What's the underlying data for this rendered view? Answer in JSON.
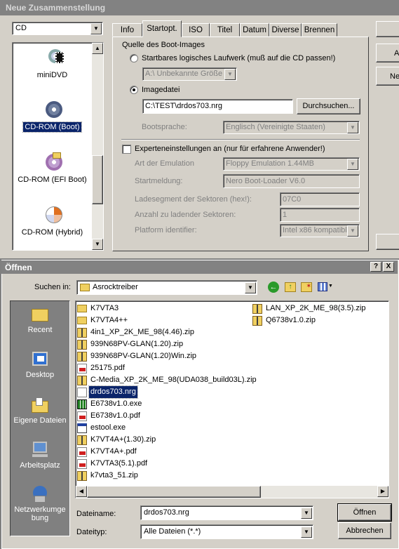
{
  "window": {
    "title": "Neue Zusammenstellung"
  },
  "disc_type": {
    "value": "CD"
  },
  "sidebar_items": [
    {
      "label": "miniDVD",
      "icon": "minidvd-icon"
    },
    {
      "label": "CD-ROM (Boot)",
      "icon": "cd-boot-icon",
      "selected": true
    },
    {
      "label": "CD-ROM (EFI Boot)",
      "icon": "cd-efi-boot-icon"
    },
    {
      "label": "CD-ROM (Hybrid)",
      "icon": "cd-hybrid-icon"
    }
  ],
  "tabs": [
    {
      "label": "Info"
    },
    {
      "label": "Startopt.",
      "active": true
    },
    {
      "label": "ISO"
    },
    {
      "label": "Titel"
    },
    {
      "label": "Datum"
    },
    {
      "label": "Diverse"
    },
    {
      "label": "Brennen"
    }
  ],
  "boot": {
    "group_title": "Quelle des Boot-Images",
    "radio_drive": "Startbares logisches Laufwerk (muß auf die CD passen!)",
    "drive_value": "A:\\  Unbekannte Größe",
    "radio_image": "Imagedatei",
    "image_path": "C:\\TEST\\drdos703.nrg",
    "browse_button": "Durchsuchen...",
    "language_label": "Bootsprache:",
    "language_value": "Englisch (Vereinigte Staaten)",
    "expert_checkbox": "Experteneinstellungen an (nur für erfahrene Anwender!)",
    "emulation_label": "Art der Emulation",
    "emulation_value": "Floppy Emulation 1.44MB",
    "message_label": "Startmeldung:",
    "message_value": "Nero Boot-Loader V6.0",
    "segment_label": "Ladesegment der Sektoren (hex!):",
    "segment_value": "07C0",
    "sectors_label": "Anzahl zu ladender Sektoren:",
    "sectors_value": "1",
    "platform_label": "Platform identifier:",
    "platform_value": "Intel x86 kompatibl"
  },
  "right_buttons": [
    "A",
    "Ne"
  ],
  "dialog": {
    "title": "Öffnen",
    "help_btn": "?",
    "close_btn": "X",
    "look_in_label": "Suchen in:",
    "look_in_value": "Asrocktreiber",
    "places": [
      {
        "label": "Recent",
        "icon": "recent-folder-icon"
      },
      {
        "label": "Desktop",
        "icon": "desktop-icon"
      },
      {
        "label": "Eigene Dateien",
        "icon": "my-documents-icon"
      },
      {
        "label": "Arbeitsplatz",
        "icon": "my-computer-icon"
      },
      {
        "label": "Netzwerkumge bung",
        "icon": "network-icon"
      }
    ],
    "files_col1": [
      {
        "name": "K7VTA3",
        "type": "folder"
      },
      {
        "name": "K7VTA4++",
        "type": "folder"
      },
      {
        "name": "4in1_XP_2K_ME_98(4.46).zip",
        "type": "zip"
      },
      {
        "name": "939N68PV-GLAN(1.20).zip",
        "type": "zip"
      },
      {
        "name": "939N68PV-GLAN(1.20)Win.zip",
        "type": "zip"
      },
      {
        "name": "25175.pdf",
        "type": "pdf"
      },
      {
        "name": "C-Media_XP_2K_ME_98(UDA038_build03L).zip",
        "type": "zip"
      },
      {
        "name": "drdos703.nrg",
        "type": "nrg",
        "selected": true
      },
      {
        "name": "E6738v1.0.exe",
        "type": "exe"
      },
      {
        "name": "E6738v1.0.pdf",
        "type": "pdf"
      },
      {
        "name": "estool.exe",
        "type": "exe2"
      },
      {
        "name": "K7VT4A+(1.30).zip",
        "type": "zip"
      },
      {
        "name": "K7VT4A+.pdf",
        "type": "pdf"
      },
      {
        "name": "K7VTA3(5.1).pdf",
        "type": "pdf"
      },
      {
        "name": "k7vta3_51.zip",
        "type": "zip"
      }
    ],
    "files_col2": [
      {
        "name": "LAN_XP_2K_ME_98(3.5).zip",
        "type": "zip"
      },
      {
        "name": "Q6738v1.0.zip",
        "type": "zip"
      }
    ],
    "filename_label": "Dateiname:",
    "filename_value": "drdos703.nrg",
    "filetype_label": "Dateityp:",
    "filetype_value": "Alle Dateien (*.*)",
    "open_button": "Öffnen",
    "cancel_button": "Abbrechen"
  }
}
